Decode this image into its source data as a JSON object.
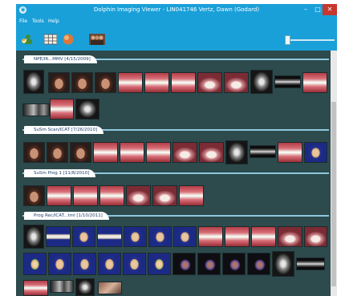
{
  "window": {
    "title": "Dolphin Imaging Viewer - LIN041746 Vertz, Dawn (Godard)",
    "minimize_glyph": "–",
    "maximize_glyph": "□",
    "close_glyph": "✕"
  },
  "menu": [
    "File",
    "Tools",
    "Help"
  ],
  "toolbar": {
    "icons": [
      "patient-icon",
      "layout-grid-icon",
      "globe-icon",
      "people-icon"
    ],
    "slider": "zoom-slider"
  },
  "sections": [
    {
      "label": "NPE/IR...MMV [4/15/2009]"
    },
    {
      "label": "SuSm Scan/ICAT [7/26/2010]"
    },
    {
      "label": "SuSm Prog 1 [11/8/2010]"
    },
    {
      "label": "Prog Rec/ICAT...tml [1/10/2011]"
    }
  ],
  "colors": {
    "accent": "#1aa0d9",
    "content_bg": "#2d4a4d",
    "section_bar": "#8fc8de",
    "close_button": "#c7372e"
  }
}
